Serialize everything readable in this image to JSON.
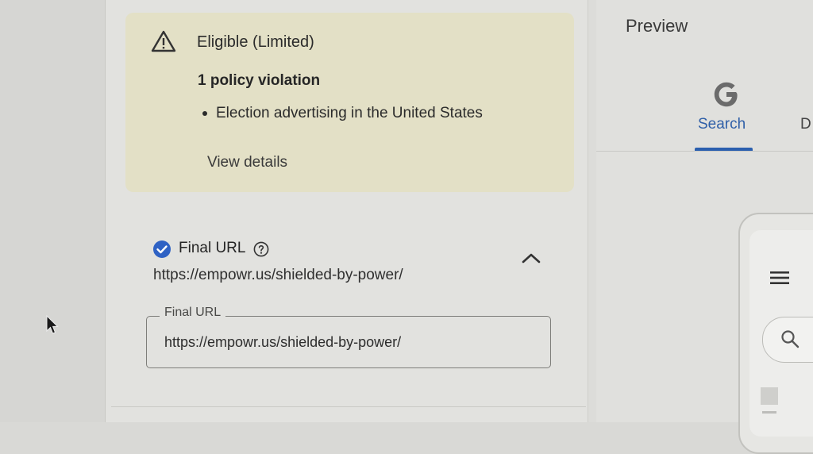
{
  "warning": {
    "status": "Eligible (Limited)",
    "violation_count": "1 policy violation",
    "violations": [
      "Election advertising in the United States"
    ],
    "view_details_label": "View details",
    "icon": "warning-icon"
  },
  "final_url": {
    "section_title": "Final URL",
    "summary_value": "https://empowr.us/shielded-by-power/",
    "field_label": "Final URL",
    "field_value": "https://empowr.us/shielded-by-power/",
    "status_icon": "check-circle-icon",
    "help_icon": "help-circle-icon",
    "toggle_icon": "chevron-up-icon"
  },
  "preview": {
    "title": "Preview",
    "tabs": [
      {
        "label": "Search",
        "active": true,
        "icon": "google-icon"
      },
      {
        "label": "D",
        "active": false
      }
    ]
  },
  "colors": {
    "warning_bg": "#e3e0c6",
    "check_blue": "#2f62c4",
    "active_tab": "#2f5fa8"
  }
}
